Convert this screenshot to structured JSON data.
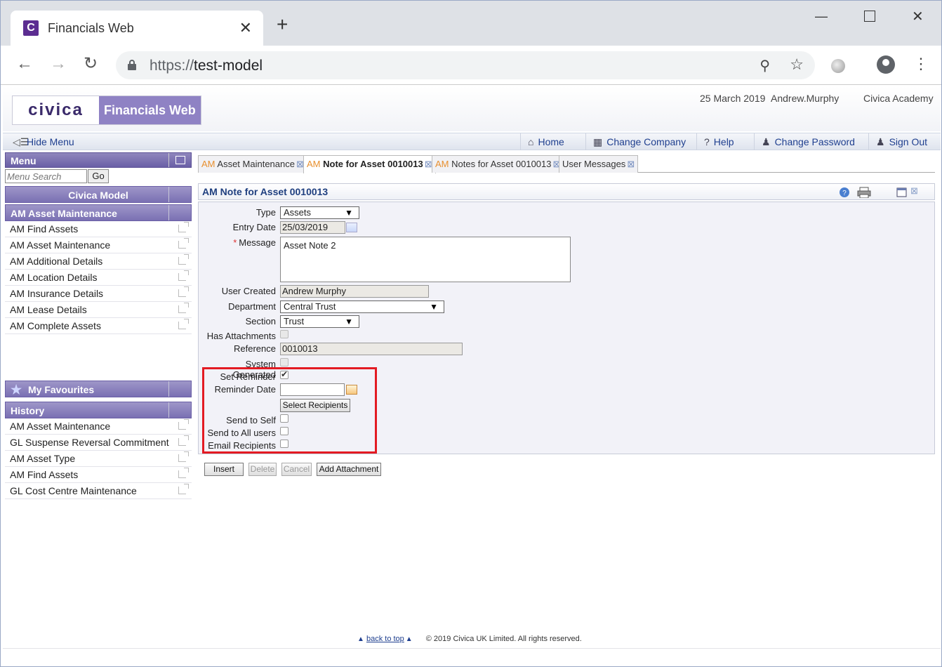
{
  "browser": {
    "tab_title": "Financials Web",
    "favicon_letter": "C",
    "url_protocol": "https://",
    "url_host": "test-model"
  },
  "app": {
    "logo_text": "civica",
    "product_name": "Financials Web",
    "date": "25 March 2019",
    "user": "Andrew.Murphy",
    "org": "Civica Academy",
    "hide_menu": "Hide Menu",
    "nav": [
      {
        "label": "Home",
        "icon": "home-icon"
      },
      {
        "label": "Change Company",
        "icon": "company-icon"
      },
      {
        "label": "Help",
        "icon": "help-icon"
      },
      {
        "label": "Change Password",
        "icon": "user-key-icon"
      },
      {
        "label": "Sign Out",
        "icon": "sign-out-icon"
      }
    ]
  },
  "sidebar": {
    "menu_title": "Menu",
    "search_placeholder": "Menu Search",
    "go_label": "Go",
    "model_title": "Civica Model",
    "section_title": "AM Asset Maintenance",
    "items": [
      "AM Find Assets",
      "AM Asset Maintenance",
      "AM Additional Details",
      "AM Location Details",
      "AM Insurance Details",
      "AM Lease Details",
      "AM Complete Assets"
    ],
    "favourites_title": "My Favourites",
    "history_title": "History",
    "history": [
      "AM Asset Maintenance",
      "GL Suspense Reversal Commitment",
      "AM Asset Type",
      "AM Find Assets",
      "GL Cost Centre Maintenance"
    ]
  },
  "tabs": [
    {
      "prefix": "AM",
      "label": "Asset Maintenance"
    },
    {
      "prefix": "AM",
      "label": "Note for Asset 0010013"
    },
    {
      "prefix": "AM",
      "label": "Notes for Asset 0010013"
    },
    {
      "prefix": "",
      "label": "User Messages"
    }
  ],
  "form": {
    "title": "AM Note for Asset 0010013",
    "type_label": "Type",
    "type_value": "Assets",
    "entry_date_label": "Entry Date",
    "entry_date_value": "25/03/2019",
    "message_label": "Message",
    "message_value": "Asset Note 2",
    "user_created_label": "User Created",
    "user_created_value": "Andrew Murphy",
    "department_label": "Department",
    "department_value": "Central Trust",
    "section_label": "Section",
    "section_value": "Trust",
    "has_attachments_label": "Has Attachments",
    "reference_label": "Reference",
    "reference_value": "0010013",
    "system_generated_label": "System Generated",
    "set_reminder_label": "Set Reminder",
    "reminder_date_label": "Reminder Date",
    "select_recipients_label": "Select Recipients",
    "send_to_self_label": "Send to Self",
    "send_to_all_label": "Send to All users",
    "email_recipients_label": "Email Recipients"
  },
  "buttons": {
    "insert": "Insert",
    "delete": "Delete",
    "cancel": "Cancel",
    "add_attachment": "Add Attachment"
  },
  "footer": {
    "back_to_top": "back to top",
    "copyright": "© 2019 Civica UK Limited. All rights reserved."
  },
  "colors": {
    "brand_purple": "#8f82c4",
    "highlight_red": "#e31b23",
    "tab_prefix_orange": "#e8902f"
  }
}
